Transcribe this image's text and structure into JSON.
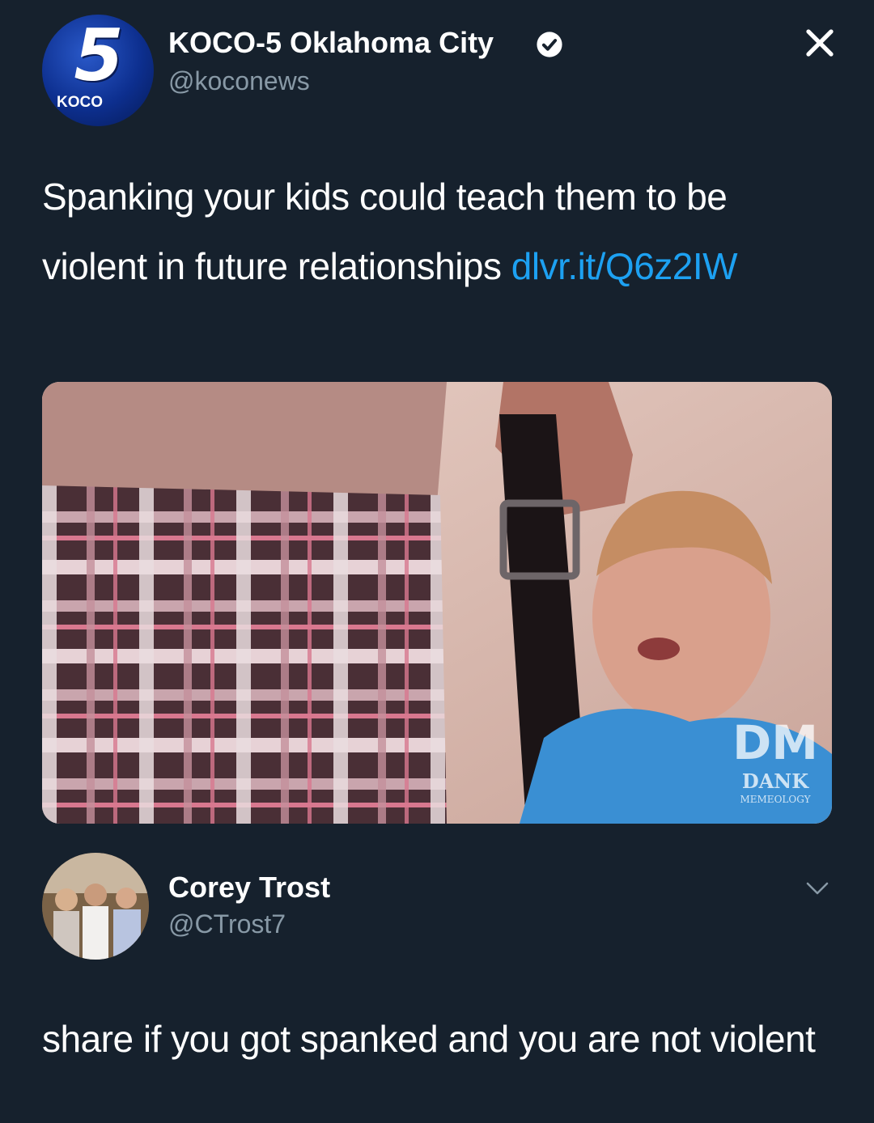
{
  "tweet": {
    "author": {
      "name": "KOCO-5 Oklahoma City",
      "handle": "@koconews",
      "avatar_text": "5",
      "avatar_brand": "KOCO"
    },
    "text": "Spanking your kids could teach them to be violent in future relationships",
    "link": "dlvr.it/Q6z2IW",
    "media": {
      "watermark_top": "DM",
      "watermark_word": "DANK",
      "watermark_sub": "MEMEOLOGY"
    }
  },
  "reply": {
    "author": {
      "name": "Corey Trost",
      "handle": "@CTrost7"
    },
    "text": "share if you got spanked and you are not violent"
  },
  "colors": {
    "background": "#16212d",
    "link": "#1da1f2",
    "secondary_text": "#8899a6"
  },
  "icons": [
    "verified-icon",
    "close-icon",
    "chevron-down-icon"
  ]
}
